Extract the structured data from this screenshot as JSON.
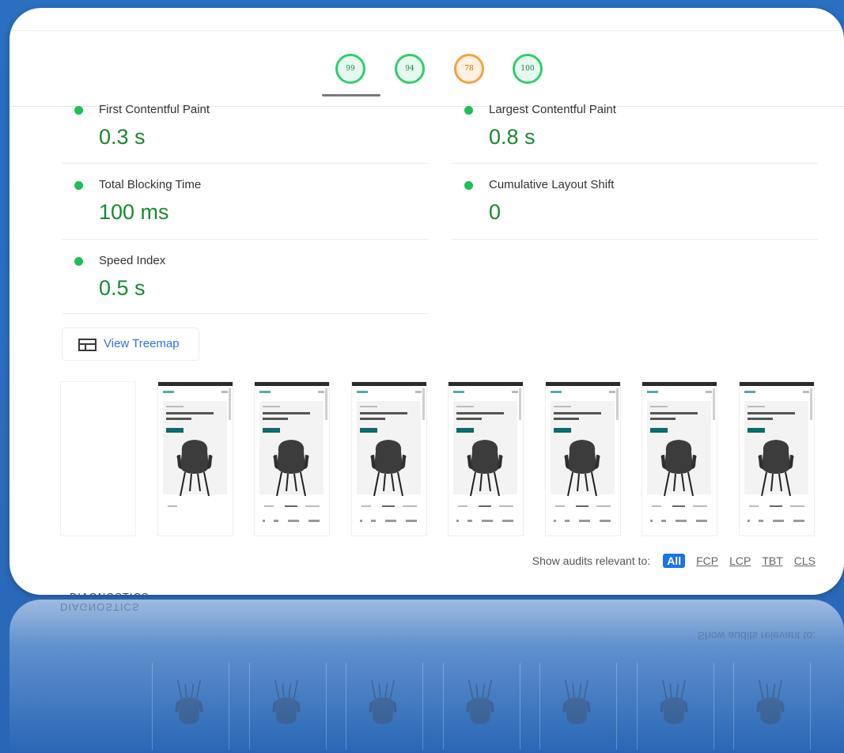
{
  "gauges": [
    {
      "score": "99",
      "tone": "green"
    },
    {
      "score": "94",
      "tone": "green"
    },
    {
      "score": "78",
      "tone": "orange"
    },
    {
      "score": "100",
      "tone": "green"
    }
  ],
  "metrics": {
    "fcp": {
      "label": "First Contentful Paint",
      "value": "0.3 s"
    },
    "lcp": {
      "label": "Largest Contentful Paint",
      "value": "0.8 s"
    },
    "tbt": {
      "label": "Total Blocking Time",
      "value": "100 ms"
    },
    "cls": {
      "label": "Cumulative Layout Shift",
      "value": "0"
    },
    "si": {
      "label": "Speed Index",
      "value": "0.5 s"
    }
  },
  "treemap": {
    "label": "View Treemap"
  },
  "filmstrip": {
    "frame_count": 8
  },
  "filter": {
    "label": "Show audits relevant to:",
    "options": [
      "All",
      "FCP",
      "LCP",
      "TBT",
      "CLS"
    ],
    "active": "All"
  },
  "section": {
    "title": "DIAGNOSTICS"
  },
  "colors": {
    "pass_green": "#1cbf58",
    "value_green": "#168a2f",
    "average_orange": "#f5a23c",
    "link_blue": "#2f6fe0",
    "active_blue": "#1a73e8",
    "background_blue": "#2b6cbd"
  },
  "icons": {
    "treemap": "treemap-icon",
    "metric_status": "pass-dot-icon"
  }
}
